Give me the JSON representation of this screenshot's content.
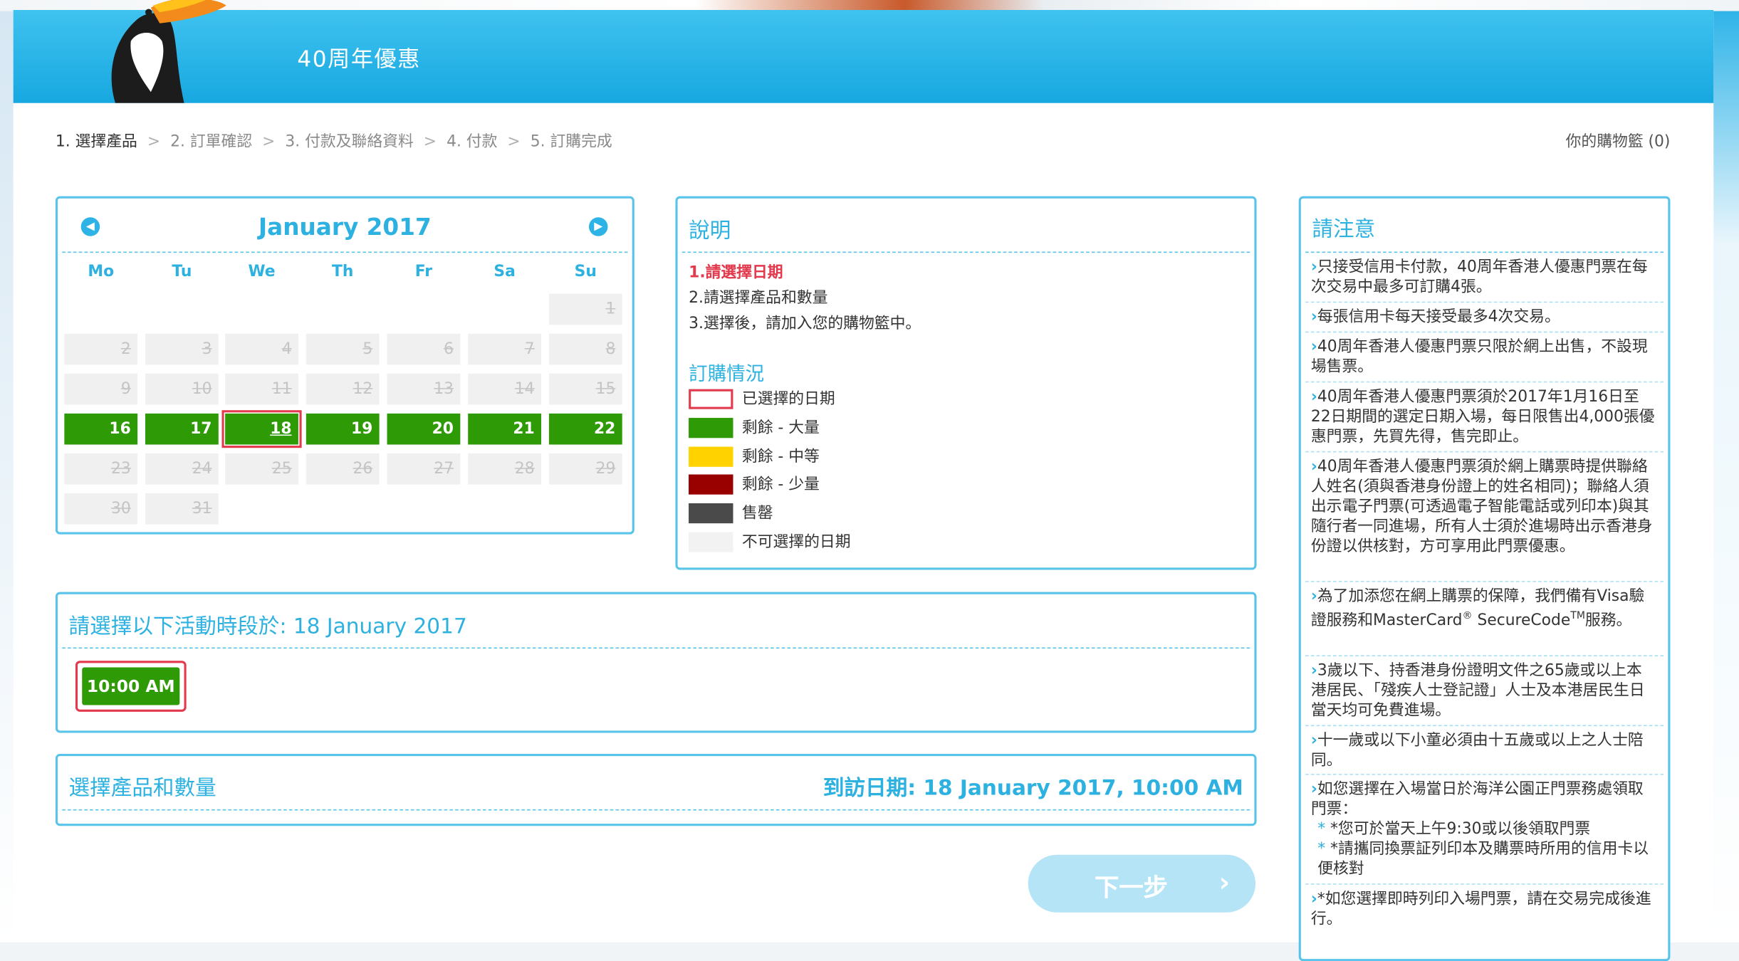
{
  "header": {
    "title": "40周年優惠"
  },
  "steps": [
    {
      "label": "1. 選擇產品",
      "active": true
    },
    {
      "label": "2. 訂單確認",
      "active": false
    },
    {
      "label": "3. 付款及聯絡資料",
      "active": false
    },
    {
      "label": "4. 付款",
      "active": false
    },
    {
      "label": "5. 訂購完成",
      "active": false
    }
  ],
  "cart": {
    "label": "你的購物籃 (0)"
  },
  "calendar": {
    "month": "January 2017",
    "prev_icon": "prev-month-icon",
    "next_icon": "next-month-icon",
    "weekdays": [
      "Mo",
      "Tu",
      "We",
      "Th",
      "Fr",
      "Sa",
      "Su"
    ],
    "weeks": [
      [
        null,
        null,
        null,
        null,
        null,
        null,
        {
          "d": "1",
          "s": "off"
        }
      ],
      [
        {
          "d": "2",
          "s": "off"
        },
        {
          "d": "3",
          "s": "off"
        },
        {
          "d": "4",
          "s": "off"
        },
        {
          "d": "5",
          "s": "off"
        },
        {
          "d": "6",
          "s": "off"
        },
        {
          "d": "7",
          "s": "off"
        },
        {
          "d": "8",
          "s": "off"
        }
      ],
      [
        {
          "d": "9",
          "s": "off"
        },
        {
          "d": "10",
          "s": "off"
        },
        {
          "d": "11",
          "s": "off"
        },
        {
          "d": "12",
          "s": "off"
        },
        {
          "d": "13",
          "s": "off"
        },
        {
          "d": "14",
          "s": "off"
        },
        {
          "d": "15",
          "s": "off"
        }
      ],
      [
        {
          "d": "16",
          "s": "avail"
        },
        {
          "d": "17",
          "s": "avail"
        },
        {
          "d": "18",
          "s": "sel"
        },
        {
          "d": "19",
          "s": "avail"
        },
        {
          "d": "20",
          "s": "avail"
        },
        {
          "d": "21",
          "s": "avail"
        },
        {
          "d": "22",
          "s": "avail"
        }
      ],
      [
        {
          "d": "23",
          "s": "off"
        },
        {
          "d": "24",
          "s": "off"
        },
        {
          "d": "25",
          "s": "off"
        },
        {
          "d": "26",
          "s": "off"
        },
        {
          "d": "27",
          "s": "off"
        },
        {
          "d": "28",
          "s": "off"
        },
        {
          "d": "29",
          "s": "off"
        }
      ],
      [
        {
          "d": "30",
          "s": "off"
        },
        {
          "d": "31",
          "s": "off"
        },
        null,
        null,
        null,
        null,
        null
      ]
    ]
  },
  "legend": {
    "title": "說明",
    "instructions": [
      "1.請選擇日期",
      "2.請選擇產品和數量",
      "3.選擇後，請加入您的購物籃中。"
    ],
    "status_title": "訂購情況",
    "items": [
      {
        "label": "已選擇的日期",
        "color": "#ffffff",
        "border": "#e23a4c"
      },
      {
        "label": "剩餘 - 大量",
        "color": "#2e9a06",
        "border": "#2e9a06"
      },
      {
        "label": "剩餘 - 中等",
        "color": "#ffd200",
        "border": "#ffd200"
      },
      {
        "label": "剩餘 - 少量",
        "color": "#990000",
        "border": "#990000"
      },
      {
        "label": "售罄",
        "color": "#4a4a4a",
        "border": "#4a4a4a"
      },
      {
        "label": "不可選擇的日期",
        "color": "#f2f2f2",
        "border": "#f2f2f2"
      }
    ]
  },
  "notes": {
    "title": "請注意",
    "items": [
      "只接受信用卡付款，40周年香港人優惠門票在每次交易中最多可訂購4張。",
      "每張信用卡每天接受最多4次交易。",
      "40周年香港人優惠門票只限於網上出售，不設現場售票。",
      "40周年香港人優惠門票須於2017年1月16日至22日期間的選定日期入場，每日限售出4,000張優惠門票，先買先得，售完即止。",
      "40周年香港人優惠門票須於網上購票時提供聯絡人姓名(須與香港身份證上的姓名相同)；聯絡人須出示電子門票(可透過電子智能電話或列印本)與其隨行者一同進場，所有人士須於進場時出示香港身份證以供核對，方可享用此門票優惠。",
      "為了加添您在網上購票的保障，我們備有Visa驗證服務和MasterCard",
      "3歲以下、持香港身份證明文件之65歲或以上本港居民、「殘疾人士登記證」人士及本港居民生日當天均可免費進場。",
      "十一歲或以下小童必須由十五歲或以上之人士陪同。",
      "如您選擇在入場當日於海洋公園正門票務處領取門票：",
      "*如您選擇即時列印入場門票，請在交易完成後進行。"
    ],
    "securecode": {
      "reg": "®",
      "brand": " SecureCode",
      "tm": "TM",
      "suffix": "服務。"
    },
    "sub_items": [
      "*您可於當天上午9:30或以後領取門票",
      "*請攜同換票証列印本及購票時所用的信用卡以便核對"
    ]
  },
  "session": {
    "title": "請選擇以下活動時段於: 18 January 2017",
    "time": "10:00 AM"
  },
  "product": {
    "title": "選擇產品和數量",
    "visit": "到訪日期: 18 January 2017, 10:00 AM"
  },
  "next_button": {
    "label": "下一步",
    "arrow": "›"
  }
}
